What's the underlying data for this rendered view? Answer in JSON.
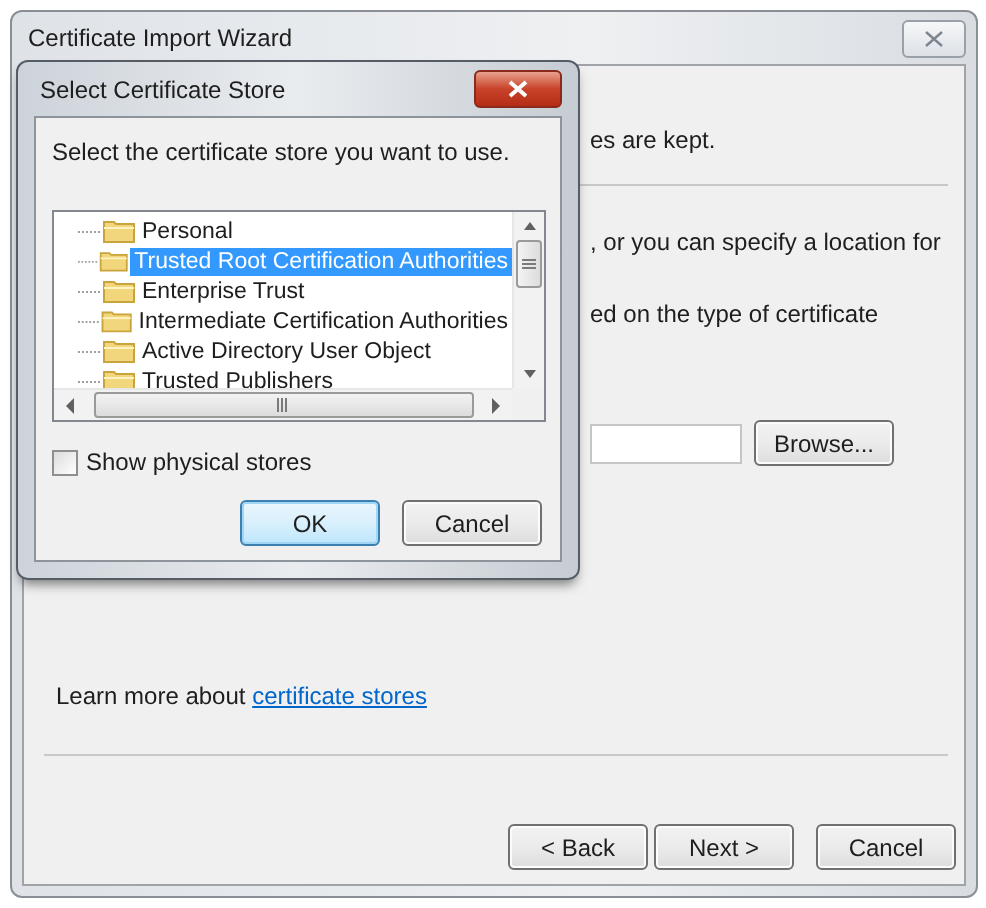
{
  "wizard": {
    "title": "Certificate Import Wizard",
    "fragments": [
      "es are kept.",
      ", or you can specify a location for",
      "ed on the type of certificate"
    ],
    "browse": "Browse...",
    "learn_more": {
      "text": "Learn more about",
      "link": "certificate stores"
    },
    "buttons": [
      {
        "label": "< Back",
        "default": false
      },
      {
        "label": "Next >",
        "default": false
      },
      {
        "label": "Cancel",
        "default": false
      }
    ]
  },
  "dialog": {
    "title": "Select Certificate Store",
    "prompt": "Select the certificate store you want to use.",
    "stores": [
      {
        "label": "Personal",
        "selected": false
      },
      {
        "label": "Trusted Root Certification Authorities",
        "selected": true
      },
      {
        "label": "Enterprise Trust",
        "selected": false
      },
      {
        "label": "Intermediate Certification Authorities",
        "selected": false
      },
      {
        "label": "Active Directory User Object",
        "selected": false
      },
      {
        "label": "Trusted Publishers",
        "selected": false
      }
    ],
    "show_physical": {
      "label": "Show physical stores",
      "checked": false
    },
    "buttons": [
      {
        "label": "OK",
        "default": true
      },
      {
        "label": "Cancel",
        "default": false
      }
    ]
  }
}
